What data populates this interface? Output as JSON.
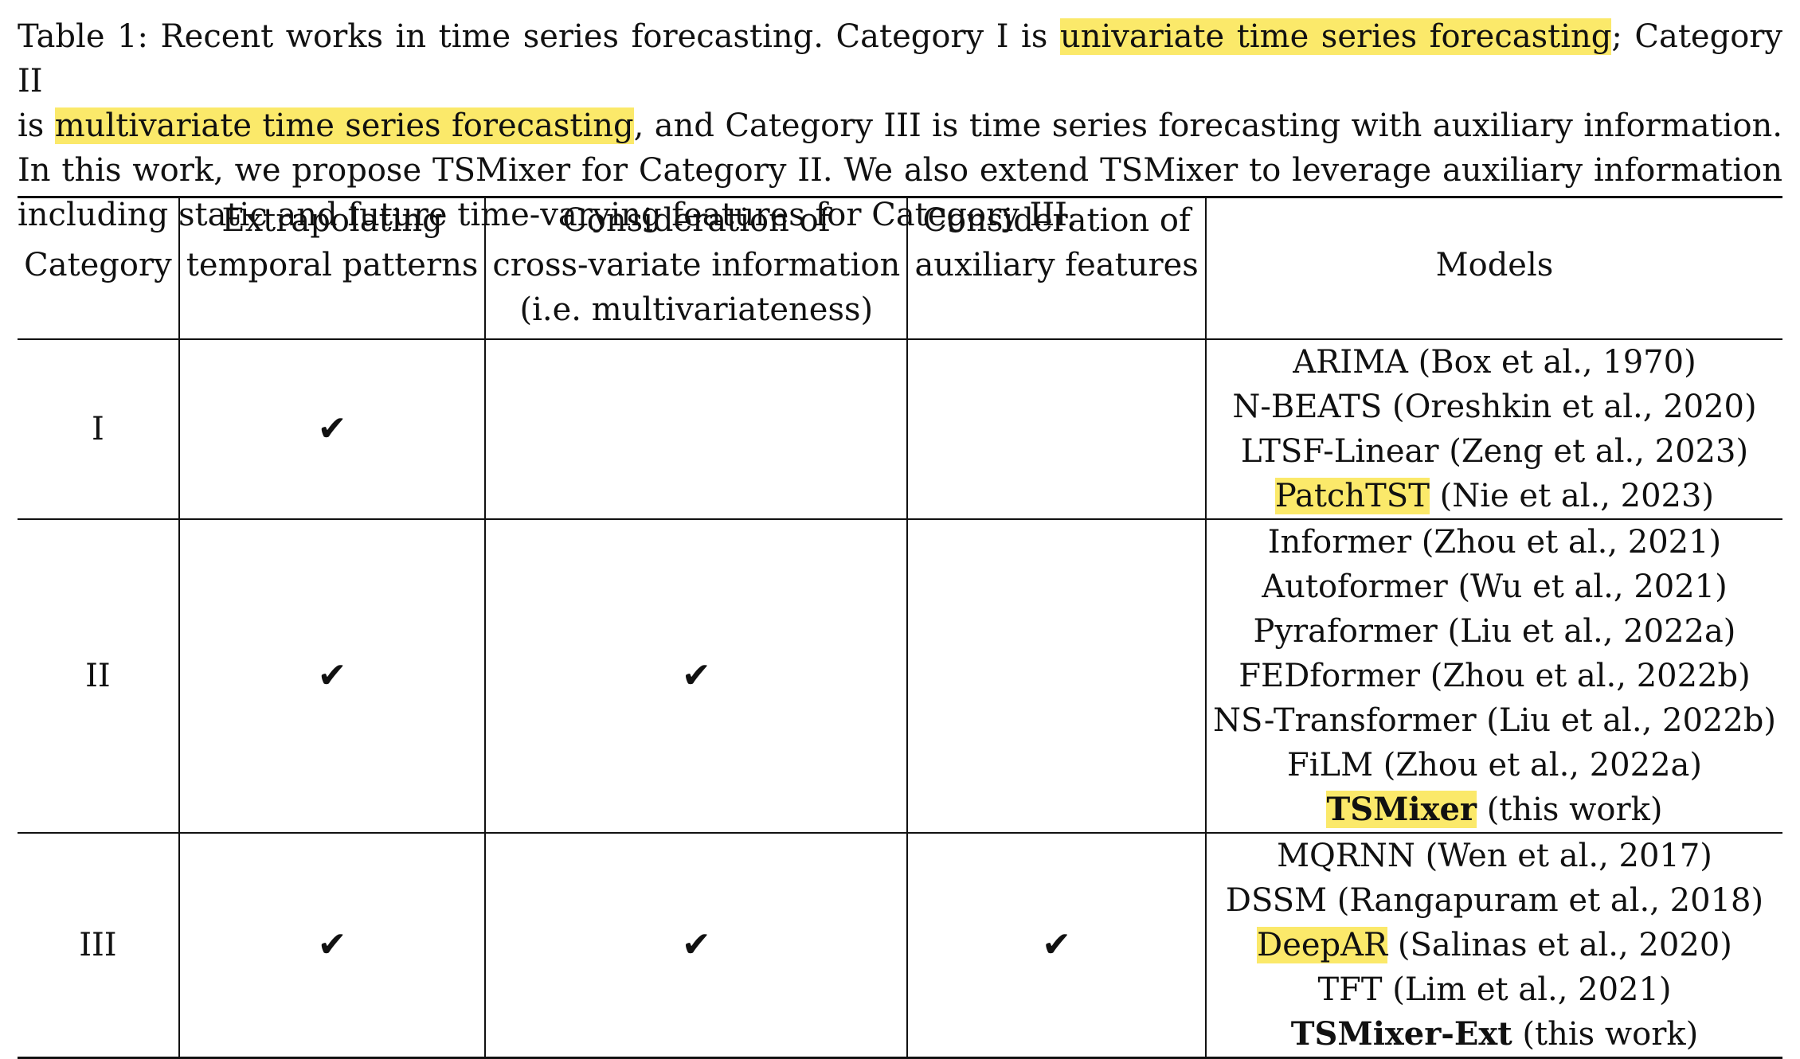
{
  "caption": {
    "line1_pre": "Table 1: Recent works in time series forecasting. Category I is ",
    "line1_hl": "univariate time series forecasting",
    "line1_post": "; Category II",
    "line2_pre": "is ",
    "line2_hl": "multivariate time series forecasting",
    "line2_post": ", and Category III is time series forecasting with auxiliary information.",
    "line3": "In this work, we propose TSMixer for Category II. We also extend TSMixer to leverage auxiliary information",
    "line4": "including static and future time-varying features for Category III."
  },
  "header": {
    "category": "Category",
    "extrapolating_l1": "Extrapolating",
    "extrapolating_l2": "temporal patterns",
    "cross_l1": "Consideration of",
    "cross_l2": "cross-variate information",
    "cross_l3": "(i.e. multivariateness)",
    "aux_l1": "Consideration of",
    "aux_l2": "auxiliary features",
    "models": "Models"
  },
  "check_symbol": "✔",
  "highlight_color": "#fbe96a",
  "rows": [
    {
      "category": "I",
      "models": [
        {
          "name": "ARIMA",
          "ref": " (Box et al., 1970)"
        },
        {
          "name": "N-BEATS",
          "ref": " (Oreshkin et al., 2020)"
        },
        {
          "name": "LTSF-Linear",
          "ref": " (Zeng et al., 2023)"
        },
        {
          "name": "PatchTST",
          "ref": " (Nie et al., 2023)",
          "highlight": true
        }
      ]
    },
    {
      "category": "II",
      "models": [
        {
          "name": "Informer",
          "ref": " (Zhou et al., 2021)"
        },
        {
          "name": "Autoformer",
          "ref": " (Wu et al., 2021)"
        },
        {
          "name": "Pyraformer",
          "ref": " (Liu et al., 2022a)"
        },
        {
          "name": "FEDformer",
          "ref": " (Zhou et al., 2022b)"
        },
        {
          "name": "NS-Transformer",
          "ref": " (Liu et al., 2022b)"
        },
        {
          "name": "FiLM",
          "ref": " (Zhou et al., 2022a)"
        },
        {
          "name": "TSMixer",
          "ref": " (this work)",
          "bold": true,
          "highlight": true
        }
      ]
    },
    {
      "category": "III",
      "models": [
        {
          "name": "MQRNN",
          "ref": " (Wen et al., 2017)"
        },
        {
          "name": "DSSM",
          "ref": " (Rangapuram et al., 2018)"
        },
        {
          "name": "DeepAR",
          "ref": " (Salinas et al., 2020)",
          "highlight": true
        },
        {
          "name": "TFT",
          "ref": " (Lim et al., 2021)"
        },
        {
          "name": "TSMixer-Ext",
          "ref": " (this work)",
          "bold": true
        }
      ]
    }
  ]
}
